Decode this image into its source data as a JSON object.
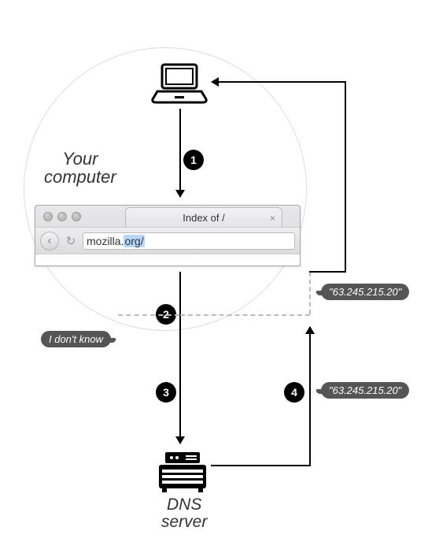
{
  "labels": {
    "computer": "Your computer",
    "dns_server": "DNS server"
  },
  "steps": {
    "s1": "1",
    "s2": "2",
    "s3": "3",
    "s4": "4"
  },
  "browser": {
    "tab_title": "Index of /",
    "url_domain": "mozilla.",
    "url_tld": "org/"
  },
  "bubbles": {
    "idk": "I don't know",
    "ip1": "\"63.245.215.20\"",
    "ip2": "\"63.245.215.20\""
  },
  "icons": {
    "laptop": "laptop-icon",
    "server": "server-icon",
    "back": "back-icon",
    "reload": "reload-icon",
    "tab_close": "close-icon"
  }
}
